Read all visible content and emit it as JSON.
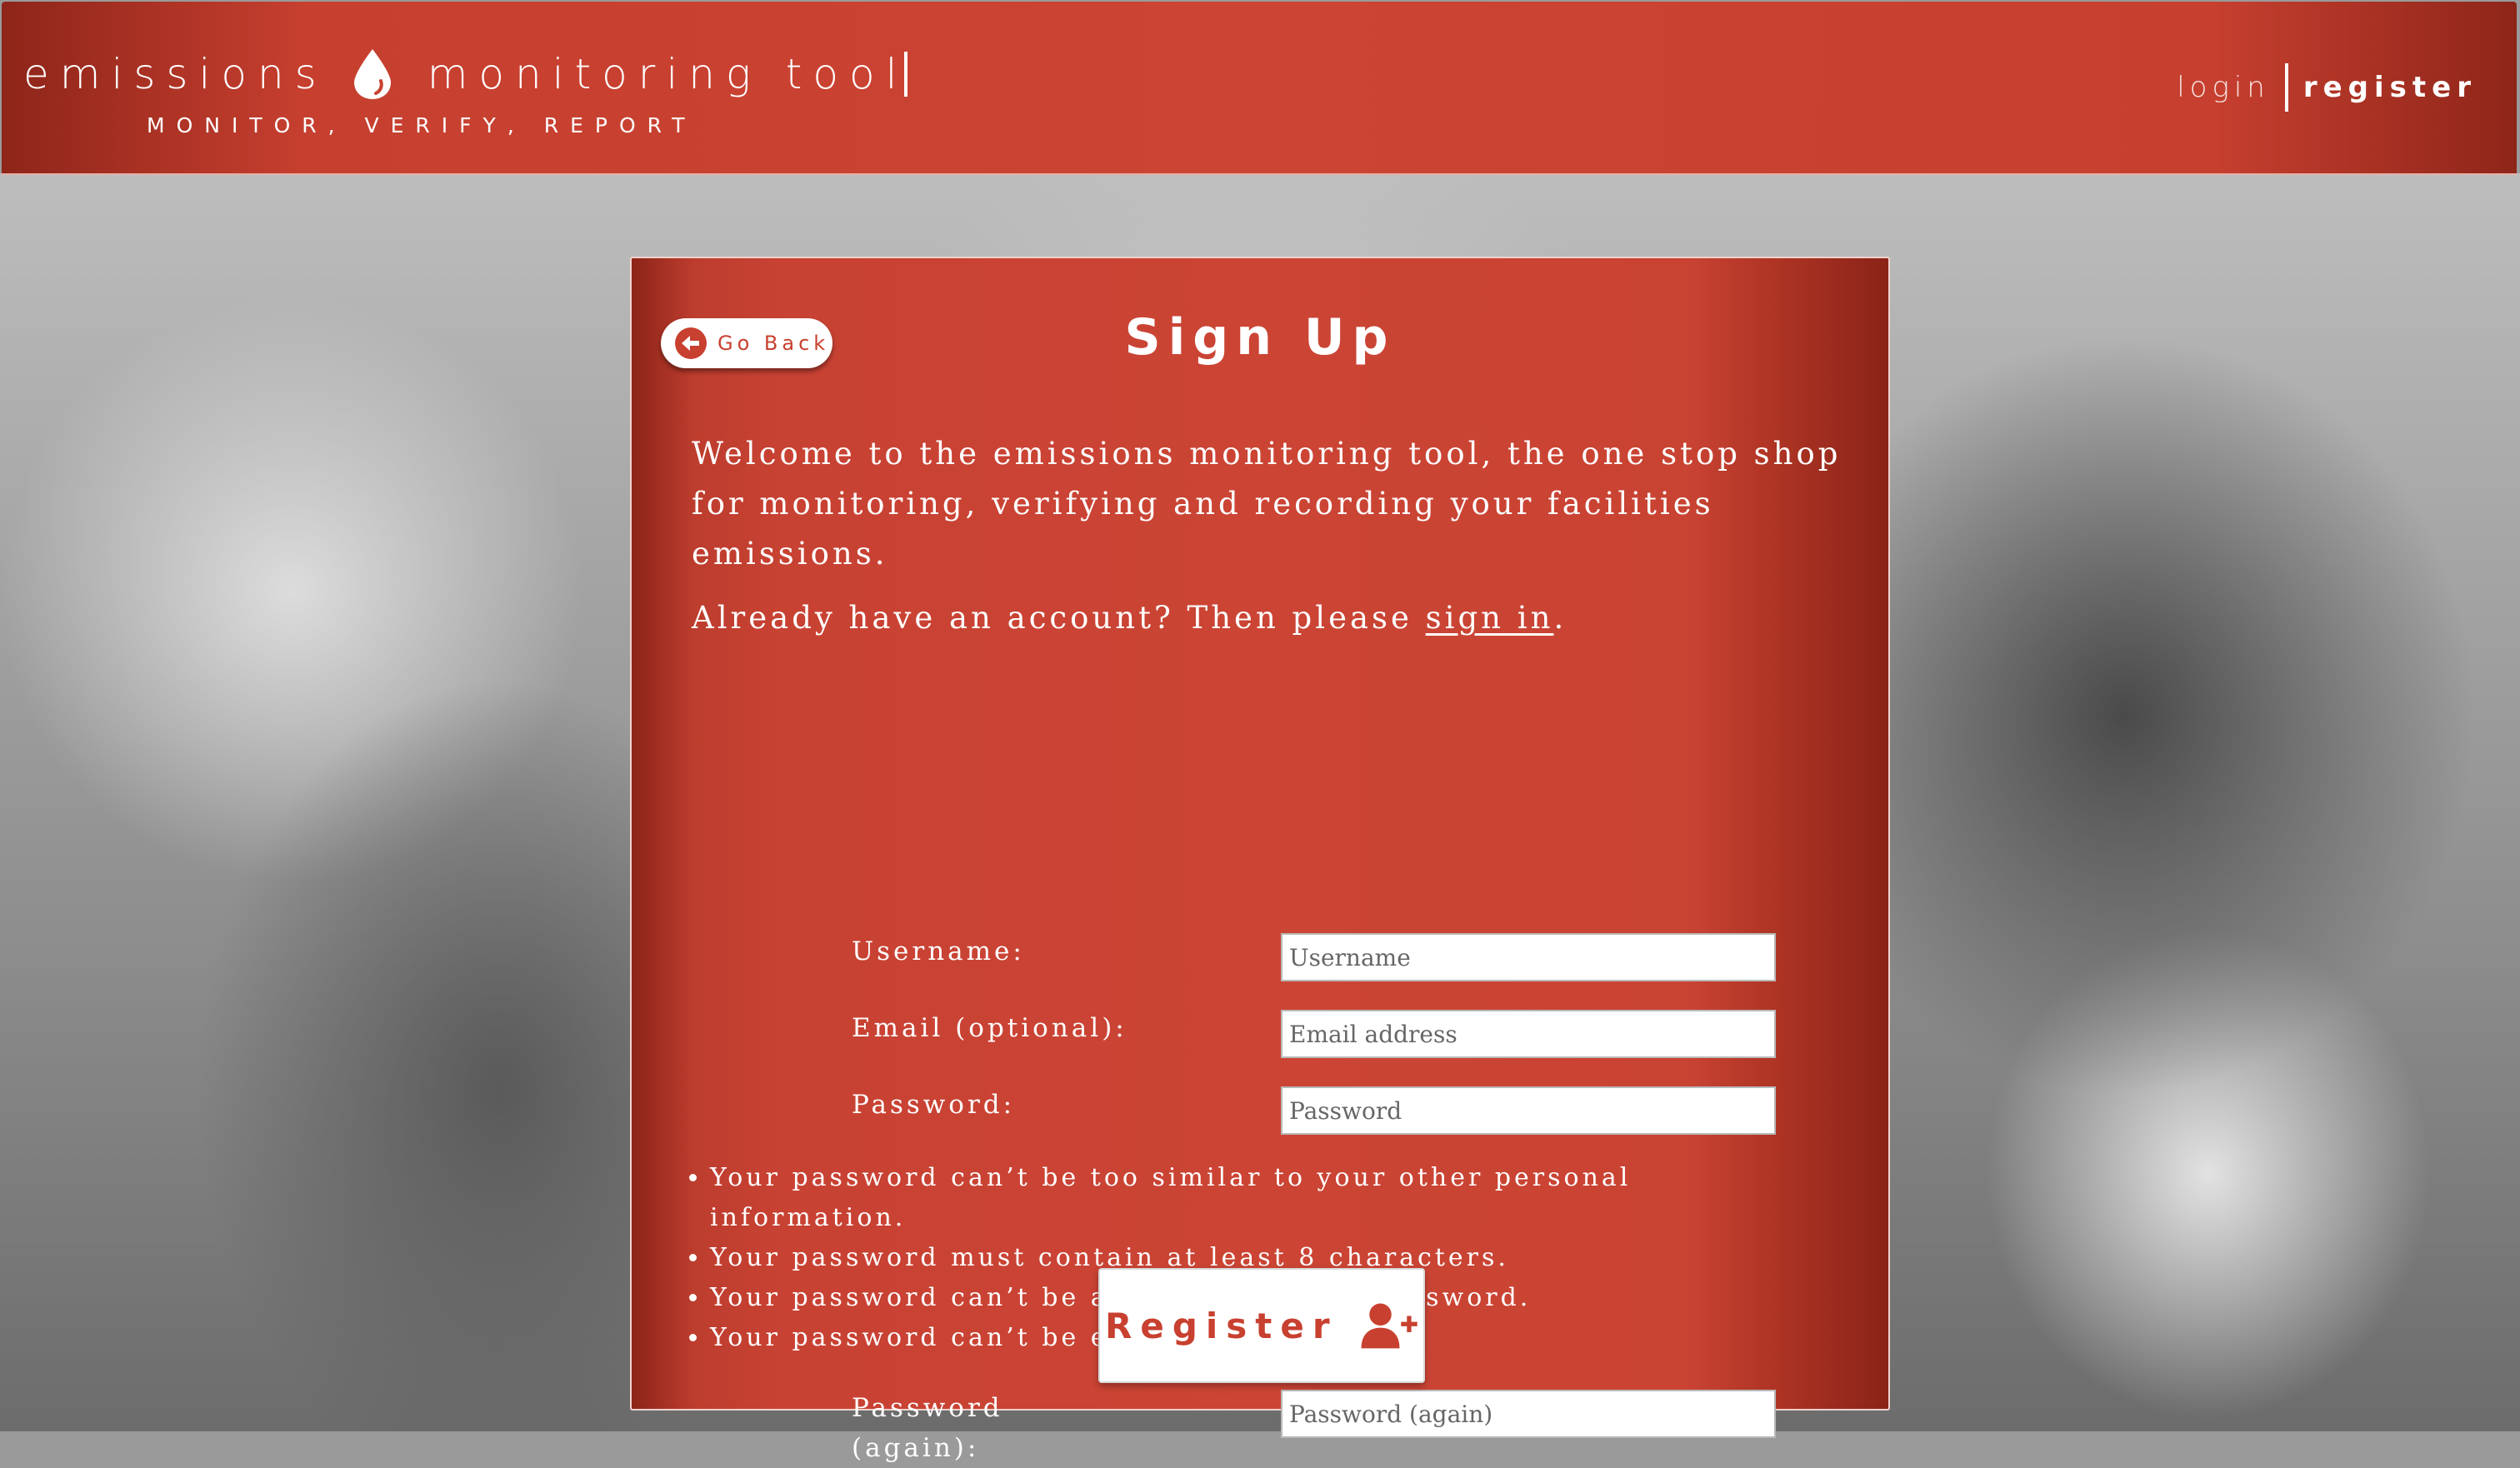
{
  "header": {
    "logo_left": "emissions",
    "logo_right": "monitoring tool",
    "tagline": "MONITOR, VERIFY, REPORT",
    "nav": {
      "login": "login",
      "register": "register"
    }
  },
  "card": {
    "go_back": "Go Back",
    "title": "Sign Up",
    "intro": "Welcome to the emissions monitoring tool, the one stop shop for monitoring, verifying and recording your facilities emissions.",
    "already_prefix": "Already have an account? Then please ",
    "signin_link": "sign in",
    "already_suffix": ".",
    "fields": {
      "username": {
        "label": "Username:",
        "placeholder": "Username"
      },
      "email": {
        "label": "Email (optional):",
        "placeholder": "Email address"
      },
      "password": {
        "label": "Password:",
        "placeholder": "Password"
      },
      "password2": {
        "label": "Password (again):",
        "placeholder": "Password (again)"
      }
    },
    "password_rules": [
      "Your password can’t be too similar to your other personal information.",
      "Your password must contain at least 8 characters.",
      "Your password can’t be a commonly used password.",
      "Your password can’t be entirely numeric."
    ],
    "register_button": "Register"
  },
  "colors": {
    "brand_red": "#c8402f",
    "brand_dark": "#8e2519",
    "text_white": "#ffffff"
  },
  "icons": {
    "logo": "droplet-icon",
    "back": "arrow-left-circle-icon",
    "register": "user-plus-icon"
  }
}
